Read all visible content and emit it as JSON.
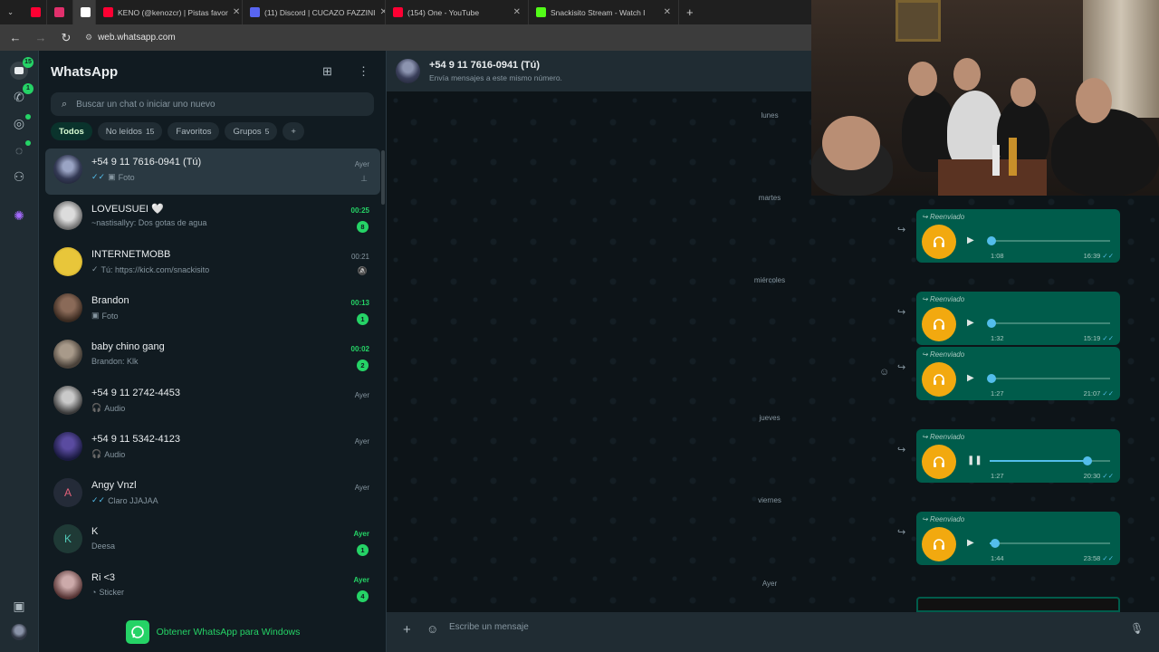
{
  "browser": {
    "tabs": [
      {
        "title": "",
        "icon": "youtube-icon",
        "color": "#ff0033"
      },
      {
        "title": "",
        "icon": "instagram-icon",
        "color": "#e1306c"
      },
      {
        "title": "",
        "icon": "audio-icon",
        "color": "#ffffff"
      },
      {
        "title": "KENO (@kenozcr) | Pistas favor",
        "icon": "youtube-icon",
        "color": "#ff0033"
      },
      {
        "title": "(11) Discord | CUCAZO FAZZINI",
        "icon": "discord-icon",
        "color": "#5865f2"
      },
      {
        "title": "(154) One - YouTube",
        "icon": "youtube-icon",
        "color": "#ff0033"
      },
      {
        "title": "Snackisito Stream - Watch I",
        "icon": "kick-icon",
        "color": "#53fc18"
      }
    ],
    "url": "web.whatsapp.com"
  },
  "rail": {
    "chats_badge": "15",
    "calls_badge": "1"
  },
  "sidebar": {
    "title": "WhatsApp",
    "search_placeholder": "Buscar un chat o iniciar uno nuevo",
    "filters": [
      {
        "label": "Todos",
        "count": ""
      },
      {
        "label": "No leídos",
        "count": "15"
      },
      {
        "label": "Favoritos",
        "count": ""
      },
      {
        "label": "Grupos",
        "count": "5"
      }
    ],
    "chats": [
      {
        "name": "+54 9 11 7616-0941 (Tú)",
        "msg": "Foto",
        "time": "Ayer",
        "unread": "",
        "selected": true,
        "icon": "pin"
      },
      {
        "name": "LOVEUSUEI 🤍",
        "msg": "~nastisallyy: Dos gotas de agua",
        "time": "00:25",
        "unread": "8"
      },
      {
        "name": "INTERNETMOBB",
        "msg": "Tú: https://kick.com/snackisito",
        "time": "00:21",
        "unread": "",
        "icon": "mute"
      },
      {
        "name": "Brandon",
        "msg": "Foto",
        "time": "00:13",
        "unread": "1"
      },
      {
        "name": "baby chino gang",
        "msg": "Brandon: Klk",
        "time": "00:02",
        "unread": "2"
      },
      {
        "name": "+54 9 11 2742-4453",
        "msg": "Audio",
        "time": "Ayer",
        "unread": ""
      },
      {
        "name": "+54 9 11 5342-4123",
        "msg": "Audio",
        "time": "Ayer",
        "unread": ""
      },
      {
        "name": "Angy Vnzl",
        "msg": "Claro JJAJAA",
        "time": "Ayer",
        "unread": "",
        "initial": "A"
      },
      {
        "name": "K",
        "msg": "Deesa",
        "time": "Ayer",
        "unread": "1",
        "initial": "K"
      },
      {
        "name": "Ri <3",
        "msg": "Sticker",
        "time": "Ayer",
        "unread": "4"
      }
    ],
    "get_app": "Obtener WhatsApp para Windows"
  },
  "chat": {
    "name": "+54 9 11 7616-0941 (Tú)",
    "subtitle": "Envía mensajes a este mismo número.",
    "days": [
      "lunes",
      "martes",
      "miércoles",
      "jueves",
      "viernes",
      "Ayer"
    ],
    "forward_label": "Reenviado",
    "audios": [
      {
        "duration": "1:08",
        "time": "16:39",
        "progress": 0.0,
        "playing": false
      },
      {
        "duration": "1:32",
        "time": "15:19",
        "progress": 0.0,
        "playing": false
      },
      {
        "duration": "1:27",
        "time": "21:07",
        "progress": 0.0,
        "playing": false
      },
      {
        "duration": "1:27",
        "time": "20:30",
        "progress": 0.8,
        "playing": true
      },
      {
        "duration": "1:44",
        "time": "23:58",
        "progress": 0.03,
        "playing": false
      }
    ],
    "composer_placeholder": "Escribe un mensaje"
  }
}
